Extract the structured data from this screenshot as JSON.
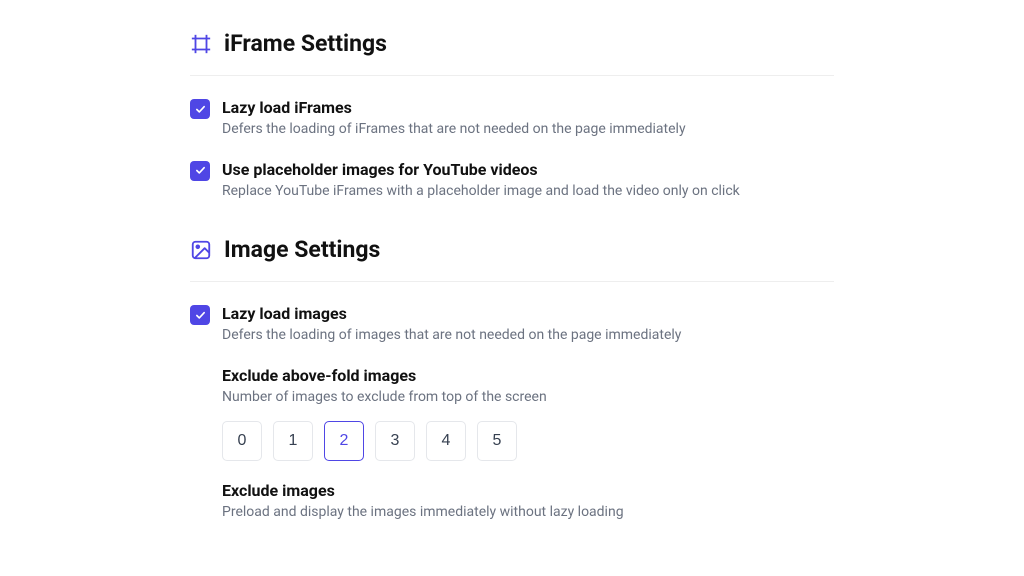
{
  "iframe_section": {
    "title": "iFrame Settings",
    "items": [
      {
        "label": "Lazy load iFrames",
        "desc": "Defers the loading of iFrames that are not needed on the page immediately",
        "checked": true
      },
      {
        "label": "Use placeholder images for YouTube videos",
        "desc": "Replace YouTube iFrames with a placeholder image and load the video only on click",
        "checked": true
      }
    ]
  },
  "image_section": {
    "title": "Image Settings",
    "lazy": {
      "label": "Lazy load images",
      "desc": "Defers the loading of images that are not needed on the page immediately",
      "checked": true
    },
    "exclude_above": {
      "label": "Exclude above-fold images",
      "desc": "Number of images to exclude from top of the screen",
      "options": [
        "0",
        "1",
        "2",
        "3",
        "4",
        "5"
      ],
      "selected": "2"
    },
    "exclude": {
      "label": "Exclude images",
      "desc": "Preload and display the images immediately without lazy loading"
    }
  }
}
